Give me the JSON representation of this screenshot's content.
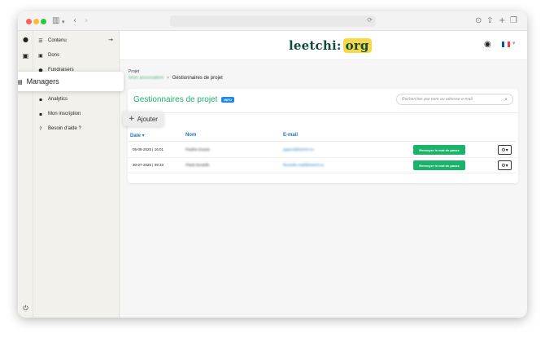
{
  "sidebar": {
    "items": [
      {
        "label": "Contenu",
        "icon": "list-icon",
        "glyph": "☰"
      },
      {
        "label": "Dons",
        "icon": "gift-icon",
        "glyph": "▣"
      },
      {
        "label": "Fundraisers",
        "icon": "user-icon",
        "glyph": "●"
      },
      {
        "label": "Analytics",
        "icon": "chart-icon",
        "glyph": "▪"
      },
      {
        "label": "Mon inscription",
        "icon": "id-card-icon",
        "glyph": "▪"
      },
      {
        "label": "Besoin d'aide ?",
        "icon": "help-icon",
        "glyph": "?"
      }
    ],
    "active": {
      "label": "Managers",
      "icon": "managers-icon",
      "glyph": "▤"
    }
  },
  "header": {
    "logo_main": "leetchi",
    "logo_sep": ":",
    "logo_org": "org",
    "flag_colors": [
      "#0055a4",
      "#ffffff",
      "#ef4135"
    ]
  },
  "breadcrumb": {
    "parent": "Projet",
    "link": "Mon association",
    "current": "Gestionnaires de projet"
  },
  "card": {
    "title": "Gestionnaires de projet",
    "badge": "INFO",
    "search_placeholder": "Rechercher par nom ou adresse e-mail",
    "add_label": "Ajouter"
  },
  "table": {
    "headers": {
      "date": "Date ▾",
      "name": "Nom",
      "email": "E-mail"
    },
    "rows": [
      {
        "date": "05-08-2025 | 16:01",
        "name": "Pauline Durant",
        "email": "pgaunt@leetchi.eu",
        "action": "Renvoyer le mot de passe"
      },
      {
        "date": "30-07-2025 | 09:33",
        "name": "Flavie Boutelle",
        "email": "fboutelle.mail@leetchi.eu",
        "action": "Renvoyer le mot de passe"
      }
    ]
  },
  "colors": {
    "accent_green": "#1bb36b",
    "link_blue": "#1e74c9",
    "logo_yellow": "#f5d94a",
    "logo_dark": "#114a3b"
  }
}
